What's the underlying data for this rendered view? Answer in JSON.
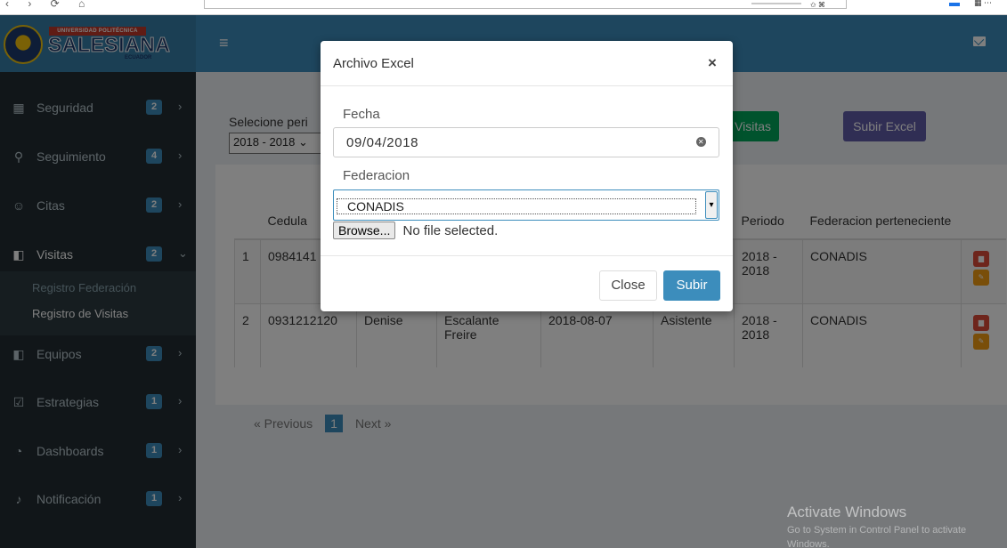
{
  "header": {
    "logo_top": "UNIVERSIDAD POLITÉCNICA",
    "logo_main": "SALESIANA",
    "logo_sub": "ECUADOR"
  },
  "sidebar": {
    "items": [
      {
        "label": "Seguridad",
        "badge": "2",
        "icon": "table-icon"
      },
      {
        "label": "Seguimiento",
        "badge": "4",
        "icon": "binoculars-icon"
      },
      {
        "label": "Citas",
        "badge": "2",
        "icon": "user-plus-icon"
      },
      {
        "label": "Visitas",
        "badge": "2",
        "icon": "map-icon"
      },
      {
        "label": "Equipos",
        "badge": "2",
        "icon": "map-icon"
      },
      {
        "label": "Estrategias",
        "badge": "1",
        "icon": "check-square-icon"
      },
      {
        "label": "Dashboards",
        "badge": "1",
        "icon": "dashboard-icon"
      },
      {
        "label": "Notificación",
        "badge": "1",
        "icon": "bell-icon"
      }
    ],
    "submenu": [
      "Registro Federación",
      "Registro de Visitas"
    ]
  },
  "content": {
    "period_label": "Selecione peri",
    "period_value": "2018 - 2018",
    "btn_visitas": "Visitas",
    "btn_excel": "Subir Excel",
    "table": {
      "headers": [
        "",
        "Cedula",
        "",
        "",
        "",
        "",
        "Periodo",
        "Federacion perteneciente",
        ""
      ],
      "rows": [
        {
          "n": "1",
          "cedula": "0984141",
          "nombre": "",
          "apellido": "",
          "fecha": "",
          "cargo": "",
          "periodo": "2018 - 2018",
          "federacion": "CONADIS"
        },
        {
          "n": "2",
          "cedula": "0931212120",
          "nombre": "Denise",
          "apellido": "Escalante Freire",
          "fecha": "2018-08-07",
          "cargo": "Asistente",
          "periodo": "2018 - 2018",
          "federacion": "CONADIS"
        }
      ]
    },
    "pager": {
      "previous": "« Previous",
      "page": "1",
      "next": "Next »"
    }
  },
  "modal": {
    "title": "Archivo Excel",
    "close_x": "×",
    "fecha_label": "Fecha",
    "fecha_value": "09/04/2018",
    "federacion_label": "Federacion",
    "federacion_value": "CONADIS",
    "browse_label": "Browse...",
    "file_text": "No file selected.",
    "close_button": "Close",
    "submit_button": "Subir"
  },
  "watermark": {
    "title": "Activate Windows",
    "line1": "Go to System in Control Panel to activate",
    "line2": "Windows."
  }
}
